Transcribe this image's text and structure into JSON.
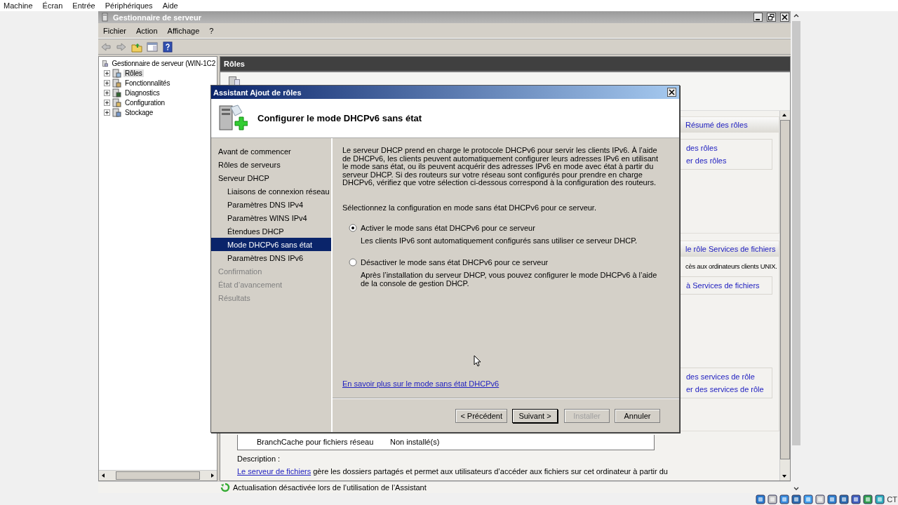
{
  "host_menu": [
    "Machine",
    "Écran",
    "Entrée",
    "Périphériques",
    "Aide"
  ],
  "window": {
    "title": "Gestionnaire de serveur"
  },
  "menu": [
    "Fichier",
    "Action",
    "Affichage",
    "?"
  ],
  "tree": {
    "root": "Gestionnaire de serveur (WIN-1C2",
    "items": [
      {
        "label": "Rôles",
        "selected": true
      },
      {
        "label": "Fonctionnalités",
        "selected": false
      },
      {
        "label": "Diagnostics",
        "selected": false
      },
      {
        "label": "Configuration",
        "selected": false
      },
      {
        "label": "Stockage",
        "selected": false
      }
    ]
  },
  "pane": {
    "title": "Rôles",
    "panels": [
      {
        "header": "Résumé des rôles",
        "link_groups": [
          [
            "des rôles",
            "er des rôles"
          ]
        ]
      },
      {
        "header": "le rôle Services de fichiers",
        "texts": [
          "cès aux ordinateurs clients UNIX."
        ],
        "link_groups": [
          [
            "à Services de fichiers"
          ],
          [
            "des services de rôle",
            "er des services de rôle"
          ]
        ]
      }
    ],
    "table_rows": [
      {
        "name": "BranchCache pour fichiers réseau",
        "status": "Non installé(s)"
      }
    ],
    "description_label": "Description :",
    "description_link": "Le serveur de fichiers",
    "description_text": " gère les dossiers partagés et permet aux utilisateurs d’accéder aux fichiers sur cet ordinateur à partir du"
  },
  "status_bar": "Actualisation désactivée lors de l’utilisation de l’Assistant",
  "dialog": {
    "title": "Assistant Ajout de rôles",
    "heading": "Configurer le mode DHCPv6 sans état",
    "nav": [
      {
        "label": "Avant de commencer",
        "selected": false,
        "disabled": false
      },
      {
        "label": "Rôles de serveurs",
        "selected": false,
        "disabled": false
      },
      {
        "label": "Serveur DHCP",
        "selected": false,
        "disabled": false,
        "children": [
          {
            "label": "Liaisons de connexion réseau",
            "selected": false,
            "disabled": false
          },
          {
            "label": "Paramètres DNS IPv4",
            "selected": false,
            "disabled": false
          },
          {
            "label": "Paramètres WINS IPv4",
            "selected": false,
            "disabled": false
          },
          {
            "label": "Étendues DHCP",
            "selected": false,
            "disabled": false
          },
          {
            "label": "Mode DHCPv6 sans état",
            "selected": true,
            "disabled": false
          },
          {
            "label": "Paramètres DNS IPv6",
            "selected": false,
            "disabled": false
          }
        ]
      },
      {
        "label": "Confirmation",
        "selected": false,
        "disabled": true
      },
      {
        "label": "État d’avancement",
        "selected": false,
        "disabled": true
      },
      {
        "label": "Résultats",
        "selected": false,
        "disabled": true
      }
    ],
    "intro": "Le serveur DHCP prend en charge le protocole DHCPv6 pour servir les clients IPv6. À l’aide de DHCPv6, les clients peuvent automatiquement configurer leurs adresses IPv6 en utilisant le mode sans état, ou ils peuvent acquérir des adresses IPv6 en mode avec état à partir du serveur DHCP. Si des routeurs sur votre réseau sont configurés pour prendre en charge DHCPv6, vérifiez que votre sélection ci-dessous correspond à la configuration des routeurs.",
    "prompt": "Sélectionnez la configuration en mode sans état DHCPv6 pour ce serveur.",
    "options": [
      {
        "label": "Activer le mode sans état DHCPv6 pour ce serveur",
        "description": "Les clients IPv6 sont automatiquement configurés sans utiliser ce serveur DHCP.",
        "selected": true
      },
      {
        "label": "Désactiver le mode sans état DHCPv6 pour ce serveur",
        "description": "Après l’installation du serveur DHCP, vous pouvez configurer le mode DHCPv6 à l’aide de la console de gestion DHCP.",
        "selected": false
      }
    ],
    "link": "En savoir plus sur le mode sans état DHCPv6",
    "buttons": [
      {
        "label": "< Précédent",
        "default": false,
        "disabled": false
      },
      {
        "label": "Suivant >",
        "default": true,
        "disabled": false
      },
      {
        "label": "Installer",
        "default": false,
        "disabled": true
      },
      {
        "label": "Annuler",
        "default": false,
        "disabled": false
      }
    ]
  },
  "host_status": {
    "key_label": "CT"
  }
}
